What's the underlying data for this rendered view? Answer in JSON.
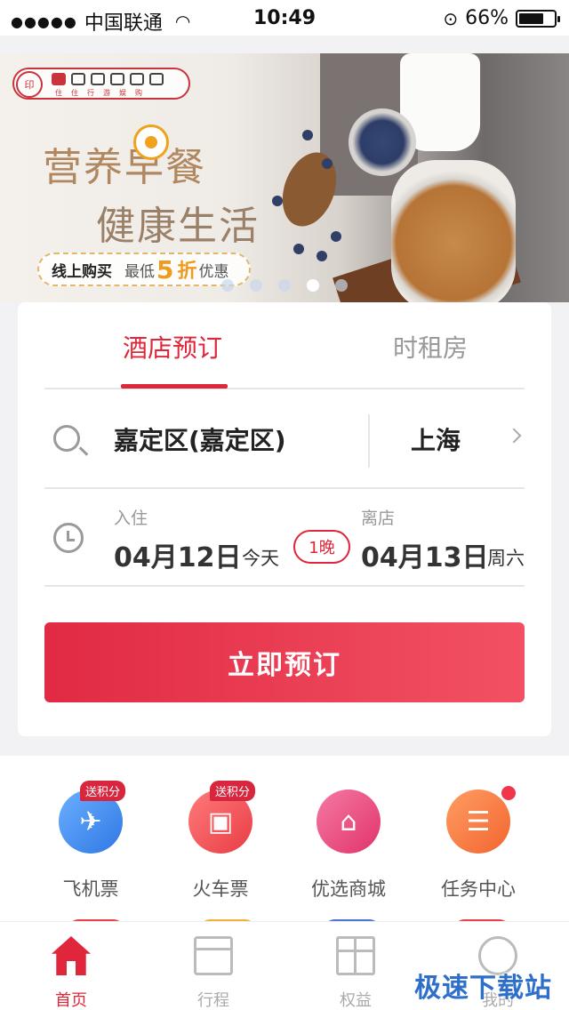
{
  "status_bar": {
    "signal_dots": "●●●●●",
    "carrier": "中国联通",
    "wifi_icon": "wifi-icon",
    "time": "10:49",
    "lock_icon": "orientation-lock-icon",
    "battery_percent": "66%",
    "battery_level": 0.66
  },
  "banner": {
    "logo_labels": [
      "住",
      "住",
      "行",
      "游",
      "娱",
      "购"
    ],
    "headline_line1": "营养早餐",
    "headline_line2": "健康生活",
    "promo_prefix": "线上购买",
    "promo_lowest": "最低",
    "promo_number": "5",
    "promo_discount": "折",
    "promo_suffix": "优惠",
    "carousel_pages": 5,
    "carousel_active": 4
  },
  "booking": {
    "tabs": [
      {
        "label": "酒店预订",
        "active": true
      },
      {
        "label": "时租房",
        "active": false
      }
    ],
    "destination": "嘉定区(嘉定区)",
    "city": "上海",
    "checkin_label": "入住",
    "checkin_date": "04月12日",
    "checkin_day": "今天",
    "nights": "1晚",
    "checkout_label": "离店",
    "checkout_date": "04月13日",
    "checkout_day": "周六",
    "book_button": "立即预订"
  },
  "services": [
    {
      "name": "飞机票",
      "icon": "airplane-icon",
      "badge": "送积分",
      "color": "#3a84ee"
    },
    {
      "name": "火车票",
      "icon": "train-icon",
      "badge": "送积分",
      "color": "#e8434a"
    },
    {
      "name": "优选商城",
      "icon": "shop-icon",
      "badge": "",
      "color": "#e33a70"
    },
    {
      "name": "任务中心",
      "icon": "task-list-icon",
      "badge": "",
      "color": "#f26c35"
    }
  ],
  "tabbar": [
    {
      "label": "首页",
      "icon": "home-icon",
      "active": true
    },
    {
      "label": "行程",
      "icon": "calendar-icon",
      "active": false
    },
    {
      "label": "权益",
      "icon": "gift-icon",
      "active": false
    },
    {
      "label": "我的",
      "icon": "profile-icon",
      "active": false
    }
  ],
  "watermark": "极速下载站",
  "colors": {
    "accent": "#e0263a",
    "button_start": "#e12a44",
    "button_end": "#f25163"
  }
}
